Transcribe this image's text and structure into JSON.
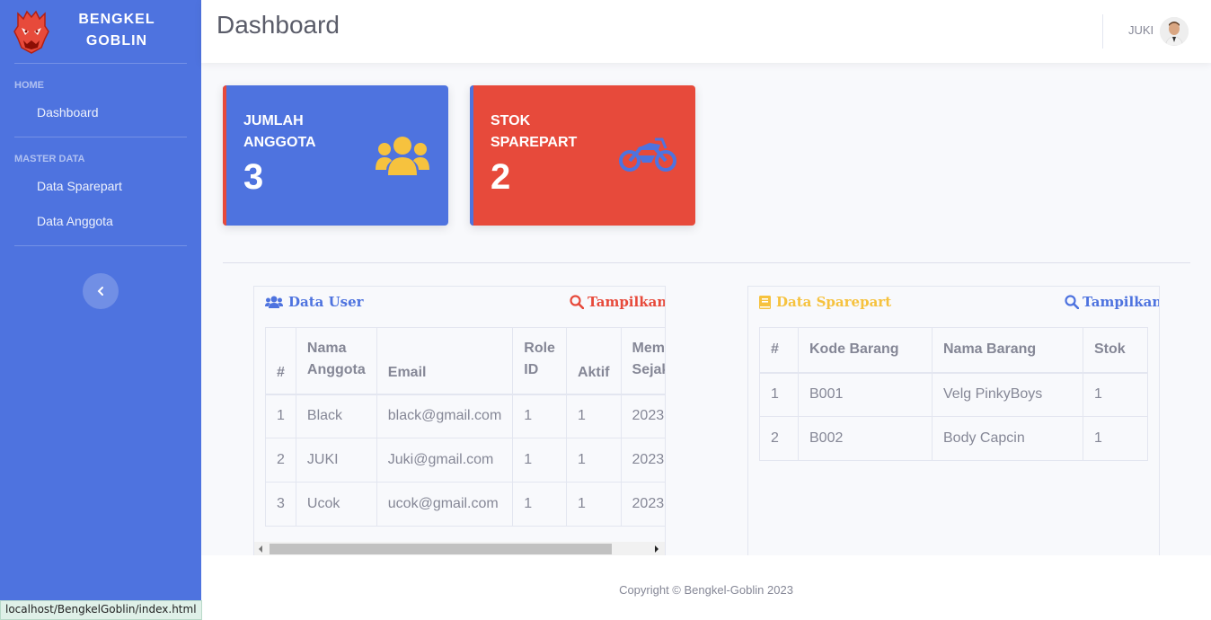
{
  "brand": {
    "name": "BENGKEL GOBLIN"
  },
  "sidebar": {
    "sections": [
      {
        "heading": "HOME",
        "items": [
          {
            "label": "Dashboard"
          }
        ]
      },
      {
        "heading": "MASTER DATA",
        "items": [
          {
            "label": "Data Sparepart"
          },
          {
            "label": "Data Anggota"
          }
        ]
      }
    ]
  },
  "topbar": {
    "title": "Dashboard",
    "user": "JUKI"
  },
  "stats": [
    {
      "label": "JUMLAH ANGGOTA",
      "value": "3",
      "color": "#4e73df",
      "bar_color": "#e74a3b",
      "icon": "users-icon",
      "icon_color": "#f6c23e"
    },
    {
      "label": "STOK SPAREPART",
      "value": "2",
      "color": "#e74a3b",
      "bar_color": "#4e73df",
      "icon": "motorcycle-icon",
      "icon_color": "#4e73df"
    }
  ],
  "user_panel": {
    "title": "Data User",
    "title_color": "#4e73df",
    "action": "Tampilkan",
    "action_color": "#e74a3b",
    "headers": [
      "#",
      "Nama Anggota",
      "Email",
      "Role ID",
      "Aktif",
      "Member Sejak"
    ],
    "rows": [
      [
        "1",
        "Black",
        "black@gmail.com",
        "1",
        "1",
        "2023"
      ],
      [
        "2",
        "JUKI",
        "Juki@gmail.com",
        "1",
        "1",
        "2023"
      ],
      [
        "3",
        "Ucok",
        "ucok@gmail.com",
        "1",
        "1",
        "2023"
      ]
    ]
  },
  "sparepart_panel": {
    "title": "Data Sparepart",
    "title_color": "#f6c23e",
    "action": "Tampilkan",
    "action_color": "#4e73df",
    "headers": [
      "#",
      "Kode Barang",
      "Nama Barang",
      "Stok"
    ],
    "rows": [
      [
        "1",
        "B001",
        "Velg PinkyBoys",
        "1"
      ],
      [
        "2",
        "B002",
        "Body Capcin",
        "1"
      ]
    ]
  },
  "footer": {
    "text": "Copyright © Bengkel-Goblin 2023"
  },
  "status_bar": {
    "url": "localhost/BengkelGoblin/index.html"
  }
}
